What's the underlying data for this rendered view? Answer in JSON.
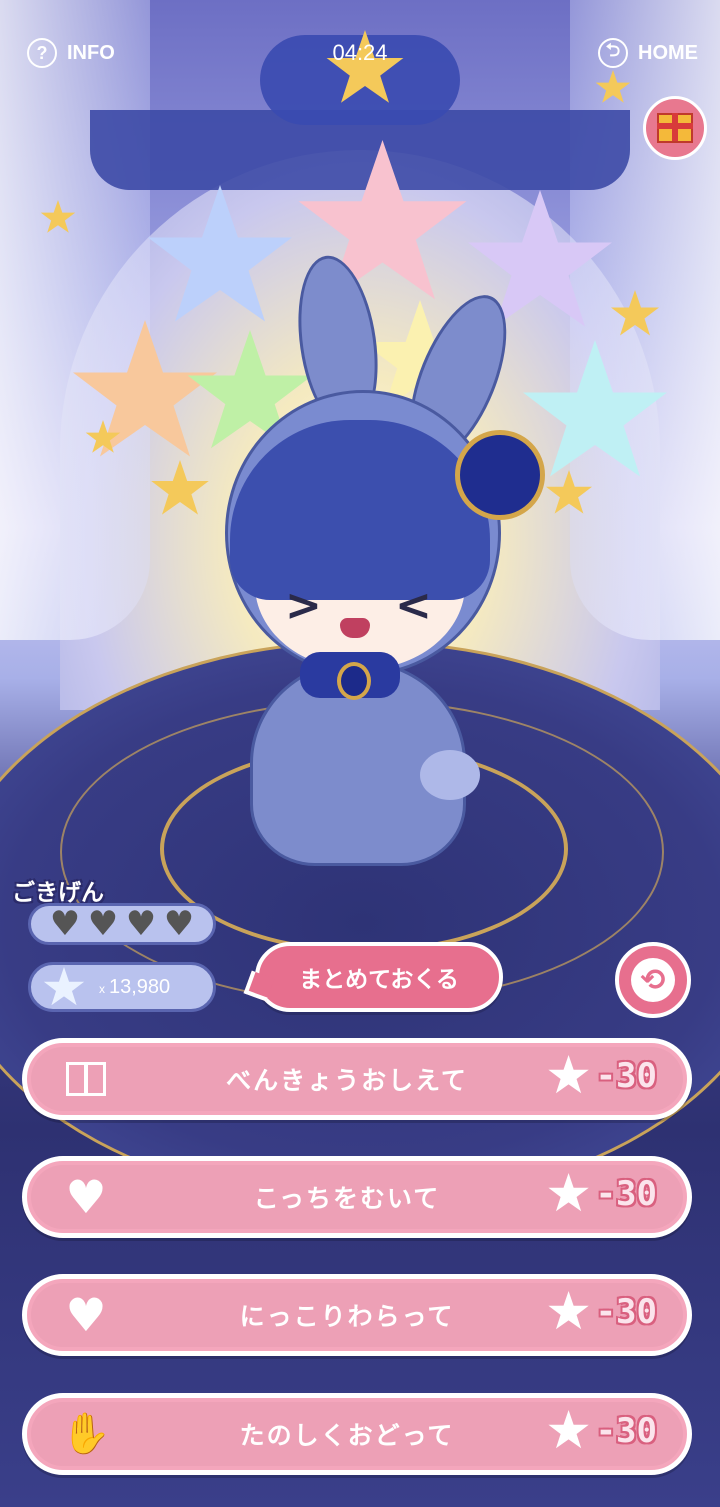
{
  "topbar": {
    "info_icon": "?",
    "info_label": "INFO",
    "clock": "04:24",
    "home_icon": "⮌",
    "home_label": "HOME"
  },
  "mood": {
    "label": "ごきげん",
    "hearts": [
      "♥",
      "♥",
      "♥",
      "♥"
    ]
  },
  "stars": {
    "prefix": "x",
    "count": "13,980"
  },
  "send_all_label": "まとめておくる",
  "back_icon": "⟲",
  "actions": [
    {
      "icon": "gift-icon",
      "label": "べんきょうおしえて",
      "cost": "-30"
    },
    {
      "icon": "heart-icon",
      "glyph": "♥",
      "label": "こっちをむいて",
      "cost": "-30"
    },
    {
      "icon": "heart-icon",
      "glyph": "♥",
      "label": "にっこりわらって",
      "cost": "-30"
    },
    {
      "icon": "clap-hands-icon",
      "glyph": "✋",
      "label": "たのしくおどって",
      "cost": "-30"
    }
  ],
  "colors": {
    "button_pink": "#e76f8e",
    "action_pink": "#f4a6bc",
    "floor_navy": "#2e3376",
    "gold": "#c9a35a"
  }
}
